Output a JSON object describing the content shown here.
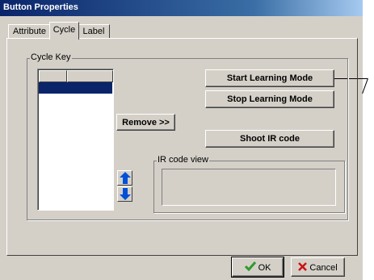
{
  "window": {
    "title": "Button Properties"
  },
  "tabs": [
    {
      "label": "Attribute",
      "active": false
    },
    {
      "label": "Cycle",
      "active": true
    },
    {
      "label": "Label",
      "active": false
    }
  ],
  "cycle_key": {
    "legend": "Cycle Key",
    "list_columns": [
      "",
      ""
    ],
    "selected_row": 0
  },
  "buttons": {
    "start_learning": "Start Learning Mode",
    "stop_learning": "Stop Learning Mode",
    "remove": "Remove >>",
    "shoot_ir": "Shoot IR code",
    "ok": "OK",
    "cancel": "Cancel"
  },
  "ir_view": {
    "legend": "IR code view",
    "value": ""
  },
  "icons": {
    "move_up": "arrow-up-icon",
    "move_down": "arrow-down-icon",
    "ok": "checkmark-icon",
    "cancel": "x-icon"
  },
  "colors": {
    "title_bar": "#0a246a",
    "selection": "#0a246a",
    "arrow_blue": "#0050d8",
    "ok_green": "#2e9a2e",
    "cancel_red": "#cc1111"
  }
}
